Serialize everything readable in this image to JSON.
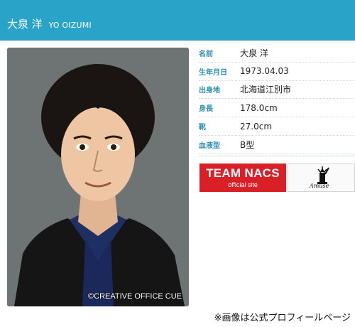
{
  "header": {
    "name_jp": "大泉 洋",
    "name_romaji": "YO OIZUMI",
    "color": "#2aa3c8"
  },
  "photo": {
    "credit": "©CREATIVE OFFICE CUE"
  },
  "profile": {
    "rows": [
      {
        "label": "名前",
        "value": "大泉 洋"
      },
      {
        "label": "生年月日",
        "value": "1973.04.03"
      },
      {
        "label": "出身地",
        "value": "北海道江別市"
      },
      {
        "label": "身長",
        "value": "178.0cm"
      },
      {
        "label": "靴",
        "value": "27.0cm"
      },
      {
        "label": "血液型",
        "value": "B型"
      }
    ],
    "label_color": "#2b8fb5"
  },
  "banners": {
    "team": {
      "title": "TEAM NACS",
      "subtitle": "official site",
      "color": "#d92027"
    },
    "amuse": {
      "text": "Amuse",
      "icon": "statue-of-liberty-icon"
    }
  },
  "caption": "※画像は公式プロフィールページ"
}
